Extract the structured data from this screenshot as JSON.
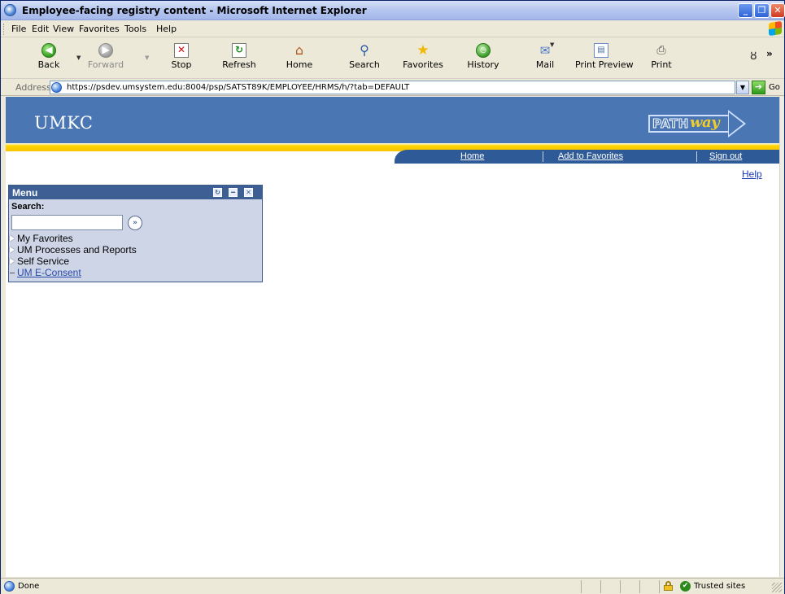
{
  "window": {
    "title": "Employee-facing registry content - Microsoft Internet Explorer",
    "minimize_glyph": "_",
    "maximize_glyph": "❐",
    "close_glyph": "✕"
  },
  "menubar": {
    "items": [
      "File",
      "Edit",
      "View",
      "Favorites",
      "Tools",
      "Help"
    ]
  },
  "toolbar": {
    "back": "Back",
    "forward": "Forward",
    "stop": "Stop",
    "refresh": "Refresh",
    "home": "Home",
    "search": "Search",
    "favorites": "Favorites",
    "history": "History",
    "mail": "Mail",
    "print_preview": "Print Preview",
    "print": "Print",
    "more": "»",
    "icons": {
      "back": "back-arrow-icon",
      "forward": "forward-arrow-icon",
      "stop": "stop-icon",
      "refresh": "refresh-icon",
      "home": "home-icon",
      "search": "search-icon",
      "favorites": "star-icon",
      "history": "history-icon",
      "mail": "mail-icon",
      "print_preview": "print-preview-icon",
      "print": "printer-icon"
    }
  },
  "address": {
    "label": "Address",
    "url": "https://psdev.umsystem.edu:8004/psp/SATST89K/EMPLOYEE/HRMS/h/?tab=DEFAULT",
    "go": "Go"
  },
  "page": {
    "banner_color": "#4a77b4",
    "accent_yellow": "#f6c400",
    "logo": "UMKC",
    "pathway_logo_path": "PATH",
    "pathway_logo_way": "way",
    "nav": {
      "home": "Home",
      "add_to_favorites": "Add to Favorites",
      "sign_out": "Sign out"
    },
    "help": "Help"
  },
  "menu_pagelet": {
    "title": "Menu",
    "search_label": "Search:",
    "search_value": "",
    "search_go_glyph": "»",
    "items": [
      {
        "label": "My Favorites",
        "type": "folder"
      },
      {
        "label": "UM Processes and Reports",
        "type": "folder"
      },
      {
        "label": "Self Service",
        "type": "folder"
      },
      {
        "label": "UM E-Consent",
        "type": "link"
      }
    ]
  },
  "status": {
    "text": "Done",
    "zone": "Trusted sites"
  }
}
